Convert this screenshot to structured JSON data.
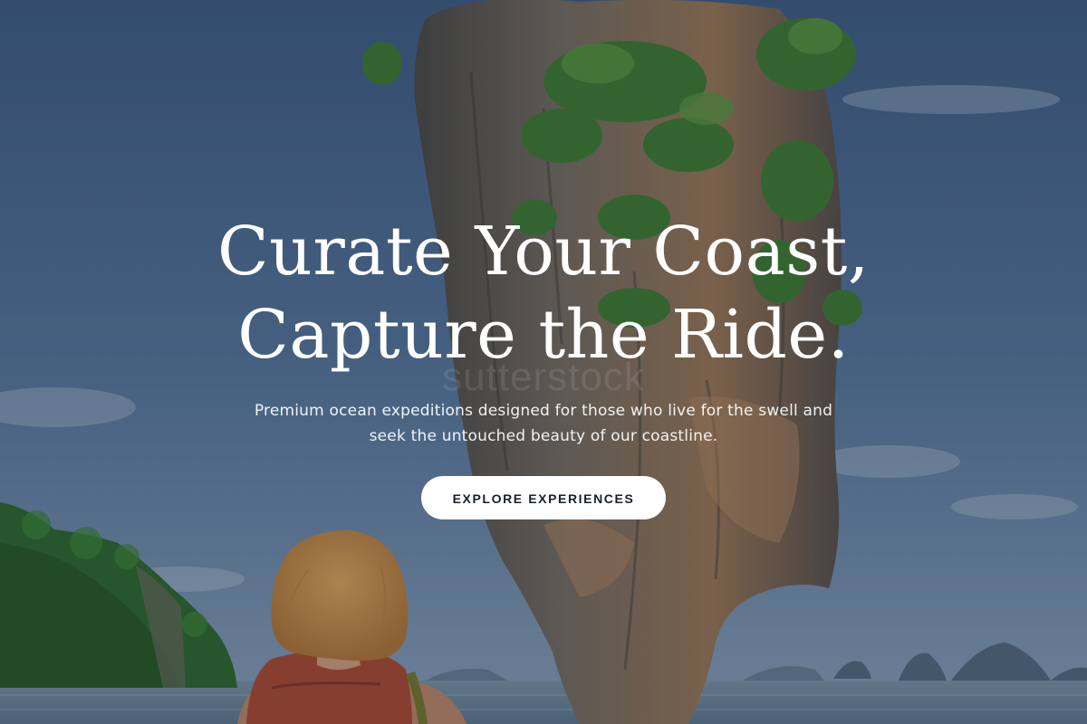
{
  "hero": {
    "headline_line1": "Curate Your Coast,",
    "headline_line2": "Capture the Ride.",
    "subtitle": "Premium ocean expeditions designed for those who live for the swell and seek the untouched beauty of our coastline.",
    "cta_label": "EXPLORE EXPERIENCES",
    "watermark": "sutterstock"
  },
  "colors": {
    "sky": "#4a6a92",
    "sea": "#7d97a8",
    "rock": "#6e6254",
    "foliage": "#3f7a35",
    "backpack": "#b24a30",
    "hair": "#d89b4c",
    "button_bg": "#ffffff",
    "button_text": "#1a1f2b"
  }
}
